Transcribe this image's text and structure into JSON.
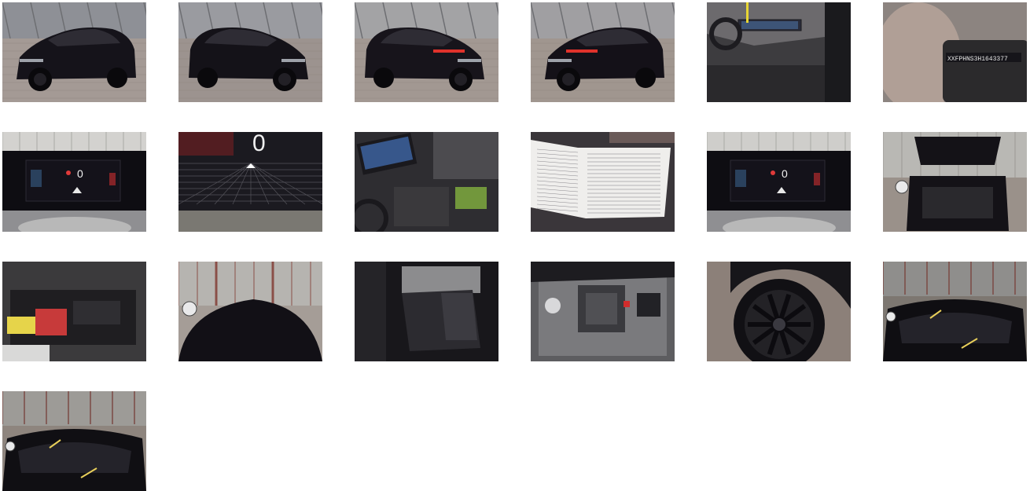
{
  "gallery": {
    "photos": [
      {
        "subject": "car-front-left",
        "colors": {
          "bg": "#8e9096",
          "car": "#15131a",
          "floor": "#a49a95"
        }
      },
      {
        "subject": "car-front-right",
        "colors": {
          "bg": "#9a9ba0",
          "car": "#141218",
          "floor": "#9c938f"
        }
      },
      {
        "subject": "car-rear-right",
        "colors": {
          "bg": "#a3a3a5",
          "car": "#17141b",
          "floor": "#a29892"
        }
      },
      {
        "subject": "car-rear-left",
        "colors": {
          "bg": "#a09fa2",
          "car": "#141118",
          "floor": "#a0968f"
        }
      },
      {
        "subject": "interior-dashboard",
        "colors": {
          "bg": "#6c6a6d",
          "car": "#1a1a1d",
          "floor": "#3d3c3f"
        }
      },
      {
        "subject": "vin-plate",
        "colors": {
          "bg": "#8c8480",
          "car": "#2b2a2c",
          "floor": "#9a8c84"
        }
      },
      {
        "subject": "instrument-cluster",
        "colors": {
          "bg": "#d3d2cf",
          "car": "#0e0d12",
          "floor": "#8f8f92"
        }
      },
      {
        "subject": "instrument-cluster-closeup",
        "colors": {
          "bg": "#1b1a20",
          "car": "#0e0d12",
          "floor": "#7a7872"
        }
      },
      {
        "subject": "infotainment-console",
        "colors": {
          "bg": "#5b5a5d",
          "car": "#1a191d",
          "floor": "#2e2d31"
        }
      },
      {
        "subject": "service-booklet",
        "colors": {
          "bg": "#efeeec",
          "car": "#1c1a1e",
          "floor": "#3a363a"
        }
      },
      {
        "subject": "instrument-cluster",
        "colors": {
          "bg": "#cfcecb",
          "car": "#0e0d12",
          "floor": "#8f8f92"
        }
      },
      {
        "subject": "open-trunk",
        "colors": {
          "bg": "#b9b8b4",
          "car": "#141217",
          "floor": "#9a918a"
        }
      },
      {
        "subject": "trunk-storage",
        "colors": {
          "bg": "#3b3a3c",
          "car": "#1f1e21",
          "floor": "#2b2a2c"
        }
      },
      {
        "subject": "roof-top",
        "colors": {
          "bg": "#b6b4b0",
          "car": "#121016",
          "floor": "#a59d97"
        }
      },
      {
        "subject": "rear-seats",
        "colors": {
          "bg": "#8c8c8e",
          "car": "#18171b",
          "floor": "#3a393c"
        }
      },
      {
        "subject": "engine-bay",
        "colors": {
          "bg": "#5d5d60",
          "car": "#1d1c20",
          "floor": "#7a7a7d"
        }
      },
      {
        "subject": "wheel",
        "colors": {
          "bg": "#9a8f88",
          "car": "#17161a",
          "floor": "#8c8079"
        }
      },
      {
        "subject": "windshield",
        "colors": {
          "bg": "#8f8e8c",
          "car": "#0f0e12",
          "floor": "#7d7771"
        }
      },
      {
        "subject": "windshield-front",
        "colors": {
          "bg": "#9d9b97",
          "car": "#100f13",
          "floor": "#8e857e"
        }
      }
    ]
  }
}
